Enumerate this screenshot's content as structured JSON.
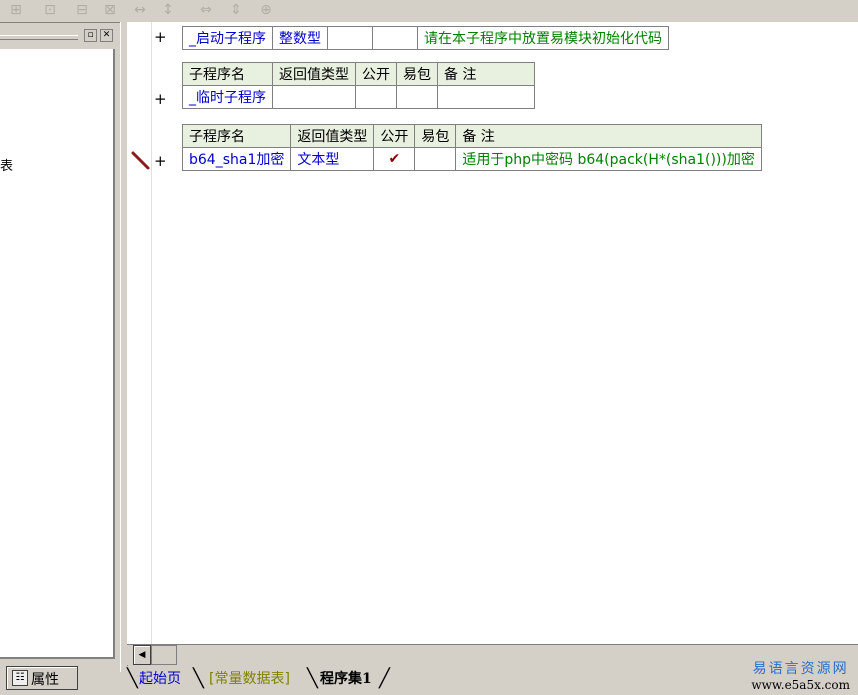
{
  "toolbar": {
    "buttons": [
      "align-left-icon",
      "align-center-icon",
      "align-right-icon",
      "align-justify-icon",
      "horizontal-space-icon",
      "vertical-space-icon",
      "same-width-icon",
      "same-height-icon",
      "same-size-icon"
    ]
  },
  "left_panel": {
    "partial_text": "表",
    "properties_tab": "属性"
  },
  "tables": [
    {
      "rows": [
        {
          "name": "_启动子程序",
          "return_type": "整数型",
          "public": "",
          "easy_pack": "",
          "note": "请在本子程序中放置易模块初始化代码"
        }
      ]
    },
    {
      "headers": [
        "子程序名",
        "返回值类型",
        "公开",
        "易包",
        "备 注"
      ],
      "rows": [
        {
          "name": "_临时子程序",
          "return_type": "",
          "public": "",
          "easy_pack": "",
          "note": ""
        }
      ]
    },
    {
      "headers": [
        "子程序名",
        "返回值类型",
        "公开",
        "易包",
        "备 注"
      ],
      "rows": [
        {
          "name": "b64_sha1加密",
          "return_type": "文本型",
          "public": "✔",
          "easy_pack": "",
          "note": "适用于php中密码 b64(pack(H*(sha1()))加密"
        }
      ]
    }
  ],
  "gutter": {
    "plus": "+"
  },
  "bottom_tabs": [
    "起始页",
    "[常量数据表]",
    "程序集1"
  ],
  "watermark": {
    "line1": "易语言资源网",
    "line2": "www.e5a5x.com"
  }
}
